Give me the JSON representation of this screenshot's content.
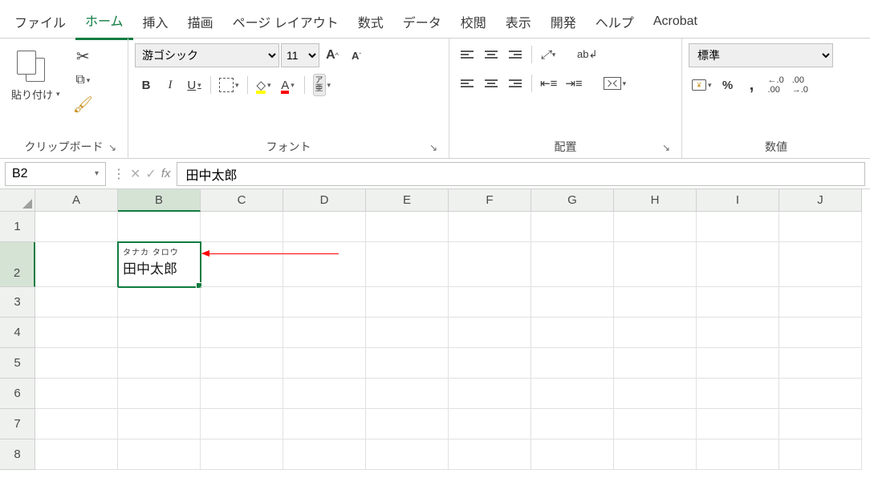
{
  "tabs": {
    "file": "ファイル",
    "home": "ホーム",
    "insert": "挿入",
    "draw": "描画",
    "pagelayout": "ページ レイアウト",
    "formulas": "数式",
    "data": "データ",
    "review": "校閲",
    "view": "表示",
    "developer": "開発",
    "help": "ヘルプ",
    "acrobat": "Acrobat"
  },
  "clipboard": {
    "paste": "貼り付け",
    "label": "クリップボード"
  },
  "font": {
    "name": "游ゴシック",
    "size": "11",
    "bold": "B",
    "italic": "I",
    "underline": "U",
    "fontcolor_letter": "A",
    "increase": "A",
    "decrease": "A",
    "phonetic_top": "ア",
    "phonetic_bot": "亜",
    "label": "フォント"
  },
  "alignment": {
    "wrap": "ab",
    "label": "配置"
  },
  "number": {
    "format": "標準",
    "percent": "%",
    "comma": ",",
    "inc_dec": "←.0",
    "dec_dec": ".00",
    "label": "数値"
  },
  "formula_bar": {
    "ref": "B2",
    "fx": "fx",
    "value": "田中太郎"
  },
  "grid": {
    "cols": [
      "A",
      "B",
      "C",
      "D",
      "E",
      "F",
      "G",
      "H",
      "I",
      "J"
    ],
    "rows": [
      "1",
      "2",
      "3",
      "4",
      "5",
      "6",
      "7",
      "8"
    ],
    "b2": {
      "ruby": "タナカ タロウ",
      "main": "田中太郎"
    }
  }
}
